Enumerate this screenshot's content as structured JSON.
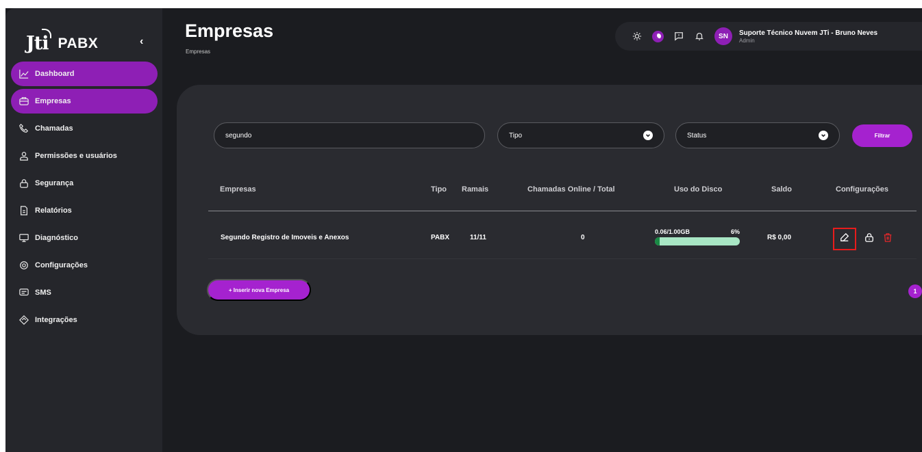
{
  "sidebar": {
    "logo_mark": "Jti",
    "logo_text": "PABX",
    "collapse_glyph": "‹",
    "items": [
      {
        "label": "Dashboard",
        "icon": "chart-area-icon",
        "active": true
      },
      {
        "label": "Empresas",
        "icon": "briefcase-icon",
        "active": true
      },
      {
        "label": "Chamadas",
        "icon": "phone-icon",
        "active": false
      },
      {
        "label": "Permissões e usuários",
        "icon": "user-icon",
        "active": false
      },
      {
        "label": "Segurança",
        "icon": "lock-icon",
        "active": false
      },
      {
        "label": "Relatórios",
        "icon": "document-icon",
        "active": false
      },
      {
        "label": "Diagnóstico",
        "icon": "monitor-icon",
        "active": false
      },
      {
        "label": "Configurações",
        "icon": "gear-icon",
        "active": false
      },
      {
        "label": "SMS",
        "icon": "message-icon",
        "active": false
      },
      {
        "label": "Integrações",
        "icon": "puzzle-icon",
        "active": false
      }
    ]
  },
  "header": {
    "title": "Empresas",
    "breadcrumb": "Empresas"
  },
  "topbar": {
    "avatar_initials": "SN",
    "user_name": "Suporte Técnico Nuvem JTi - Bruno Neves",
    "user_role": "Admin"
  },
  "filters": {
    "search_value": "segundo",
    "tipo_value": "Tipo",
    "status_value": "Status",
    "filter_button": "Filtrar"
  },
  "table": {
    "columns": [
      "Empresas",
      "Tipo",
      "Ramais",
      "Chamadas Online / Total",
      "Uso do Disco",
      "Saldo",
      "Configurações"
    ],
    "rows": [
      {
        "empresa": "Segundo Registro de Imoveis e Anexos",
        "tipo": "PABX",
        "ramais": "11/11",
        "chamadas": "0",
        "disco_label": "0.06/1.00GB",
        "disco_percent_label": "6%",
        "disco_fraction": 0.06,
        "saldo": "R$ 0,00"
      }
    ]
  },
  "add_button": "+ Inserir nova Empresa",
  "pagination": {
    "current": "1"
  },
  "colors": {
    "accent": "#a522cf",
    "nav_active": "#8e1fb5",
    "disk_fill": "#1a8a45",
    "disk_track": "#a8e6c4",
    "delete": "#e0282a",
    "highlight": "#e81c1c"
  }
}
